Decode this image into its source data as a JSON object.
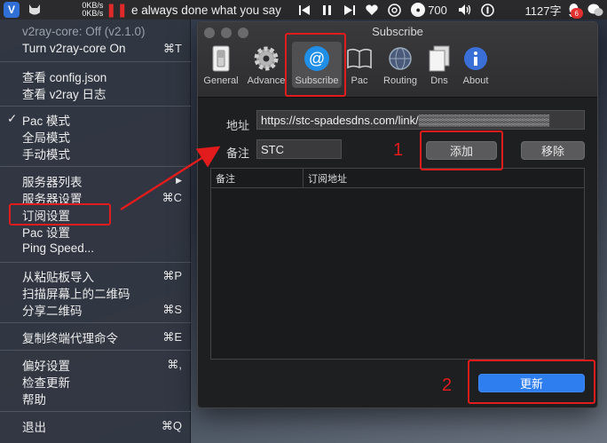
{
  "menubar": {
    "net_up": "0KB/s",
    "net_down": "0KB/s",
    "song_text": "e always done what you say",
    "counter": "700",
    "char_count": "1127字",
    "notif_badge": "6",
    "icons": [
      "v2ray-icon",
      "cat-icon",
      "pause-icon",
      "prev-track-icon",
      "pause-track-icon",
      "next-track-icon",
      "heart-icon",
      "netease-icon",
      "counter-icon",
      "volume-icon",
      "info-icon",
      "qq-icon",
      "wechat-icon"
    ]
  },
  "menu": {
    "status": "v2ray-core: Off  (v2.1.0)",
    "toggle": {
      "label": "Turn v2ray-core On",
      "shortcut": "⌘T"
    },
    "view_config": "查看 config.json",
    "view_log": "查看 v2ray 日志",
    "pac_mode": "Pac 模式",
    "global_mode": "全局模式",
    "manual_mode": "手动模式",
    "server_list": "服务器列表",
    "server_settings": {
      "label": "服务器设置",
      "shortcut": "⌘C"
    },
    "subscribe_settings": "订阅设置",
    "pac_settings": "Pac 设置",
    "ping_speed": "Ping Speed...",
    "import_clipboard": {
      "label": "从粘贴板导入",
      "shortcut": "⌘P"
    },
    "scan_qr": "扫描屏幕上的二维码",
    "share_qr": {
      "label": "分享二维码",
      "shortcut": "⌘S"
    },
    "copy_proxy_cmd": {
      "label": "复制终端代理命令",
      "shortcut": "⌘E"
    },
    "preferences": {
      "label": "偏好设置",
      "shortcut": "⌘,"
    },
    "check_update": "检查更新",
    "help": "帮助",
    "quit": {
      "label": "退出",
      "shortcut": "⌘Q"
    }
  },
  "window": {
    "title": "Subscribe",
    "toolbar": [
      "General",
      "Advance",
      "Subscribe",
      "Pac",
      "Routing",
      "Dns",
      "About"
    ],
    "url_label": "地址",
    "url_value": "https://stc-spadesdns.com/link/▒▒▒▒▒▒▒▒▒▒▒▒▒▒▒▒",
    "remark_label": "备注",
    "remark_value": "STC",
    "add_button": "添加",
    "remove_button": "移除",
    "table_headers": [
      "备注",
      "订阅地址"
    ],
    "update_button": "更新"
  },
  "annotations": {
    "step1": "1",
    "step2": "2"
  },
  "colors": {
    "annotation_red": "#e21c1c",
    "accent_blue": "#2f7ef0"
  }
}
